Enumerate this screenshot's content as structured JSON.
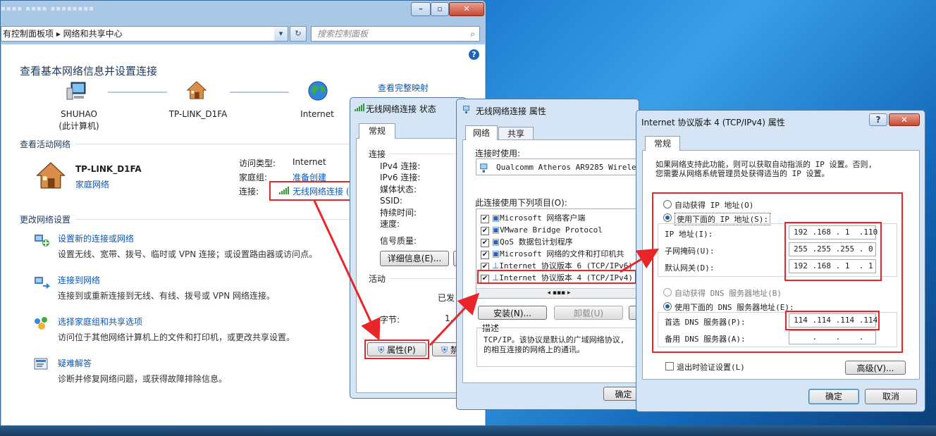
{
  "control_panel": {
    "breadcrumb": "有控制面板项  ▸  网络和共享中心",
    "search_placeholder": "搜索控制面板",
    "heading": "查看基本网络信息并设置连接",
    "view_full_map": "查看完整映射",
    "map_nodes": [
      {
        "name": "SHUHAO",
        "sub": "(此计算机)"
      },
      {
        "name": "TP-LINK_D1FA",
        "sub": ""
      },
      {
        "name": "Internet",
        "sub": ""
      }
    ],
    "active_networks_header": "查看活动网络",
    "active_network": {
      "name": "TP-LINK_D1FA",
      "type": "家庭网络",
      "access_type_label": "访问类型:",
      "access_type_value": "Internet",
      "homegroup_label": "家庭组:",
      "homegroup_value": "准备创建",
      "connection_label": "连接:",
      "connection_value": "无线网络连接 ("
    },
    "change_settings_header": "更改网络设置",
    "tasks": [
      {
        "title": "设置新的连接或网络",
        "desc": "设置无线、宽带、拨号、临时或 VPN 连接；或设置路由器或访问点。"
      },
      {
        "title": "连接到网络",
        "desc": "连接到或重新连接到无线、有线、拨号或 VPN 网络连接。"
      },
      {
        "title": "选择家庭组和共享选项",
        "desc": "访问位于其他网络计算机上的文件和打印机，或更改共享设置。"
      },
      {
        "title": "疑难解答",
        "desc": "诊断并修复网络问题，或获得故障排除信息。"
      }
    ]
  },
  "status_dialog": {
    "title": "无线网络连接 状态",
    "tab": "常规",
    "connection_group": "连接",
    "rows": [
      "IPv4 连接:",
      "IPv6 连接:",
      "媒体状态:",
      "SSID:",
      "持续时间:",
      "速度:"
    ],
    "signal_quality": "信号质量:",
    "details_button": "详细信息(E)...",
    "activity_group": "活动",
    "sent_label": "已发",
    "bytes_label": "字节:",
    "bytes_value": "1,",
    "properties_button": "属性(P)",
    "disable_button": "禁"
  },
  "props_dialog": {
    "title": "无线网络连接 属性",
    "tabs": [
      "网络",
      "共享"
    ],
    "connect_using_label": "连接时使用:",
    "adapter": "Qualcomm Atheros AR9285 Wireless",
    "items_label": "此连接使用下列项目(O):",
    "items": [
      "Microsoft 网络客户端",
      "VMware Bridge Protocol",
      "QoS 数据包计划程序",
      "Microsoft 网络的文件和打印机共",
      "Internet 协议版本 6 (TCP/IPv6)",
      "Internet 协议版本 4 (TCP/IPv4)"
    ],
    "install_button": "安装(N)...",
    "uninstall_button": "卸载(U)",
    "desc_label": "描述",
    "desc_text_1": "TCP/IP。该协议是默认的广域网络协议,",
    "desc_text_2": "的相互连接的网络上的通讯。",
    "ok_button": "确定"
  },
  "ipv4_dialog": {
    "title": "Internet 协议版本 4 (TCP/IPv4) 属性",
    "tab": "常规",
    "intro_1": "如果网络支持此功能，则可以获取自动指派的 IP 设置。否则,",
    "intro_2": "您需要从网络系统管理员处获得适当的 IP 设置。",
    "auto_ip": "自动获得 IP 地址(O)",
    "manual_ip": "使用下面的 IP 地址(S):",
    "ip_label": "IP 地址(I):",
    "ip_value": "192 .168 . 1  .110",
    "mask_label": "子网掩码(U):",
    "mask_value": "255 .255 .255 . 0",
    "gateway_label": "默认网关(D):",
    "gateway_value": "192 .168 . 1  . 1",
    "auto_dns": "自动获得 DNS 服务器地址(B)",
    "manual_dns": "使用下面的 DNS 服务器地址(E):",
    "pref_dns_label": "首选 DNS 服务器(P):",
    "pref_dns_value": "114 .114 .114 .114",
    "alt_dns_label": "备用 DNS 服务器(A):",
    "alt_dns_value": "    .    .    .",
    "validate_label": "退出时验证设置(L)",
    "advanced_button": "高级(V)...",
    "ok_button": "确定",
    "cancel_button": "取消"
  },
  "colors": {
    "annotation_red": "#e8262a",
    "link_blue": "#0b57b8"
  }
}
